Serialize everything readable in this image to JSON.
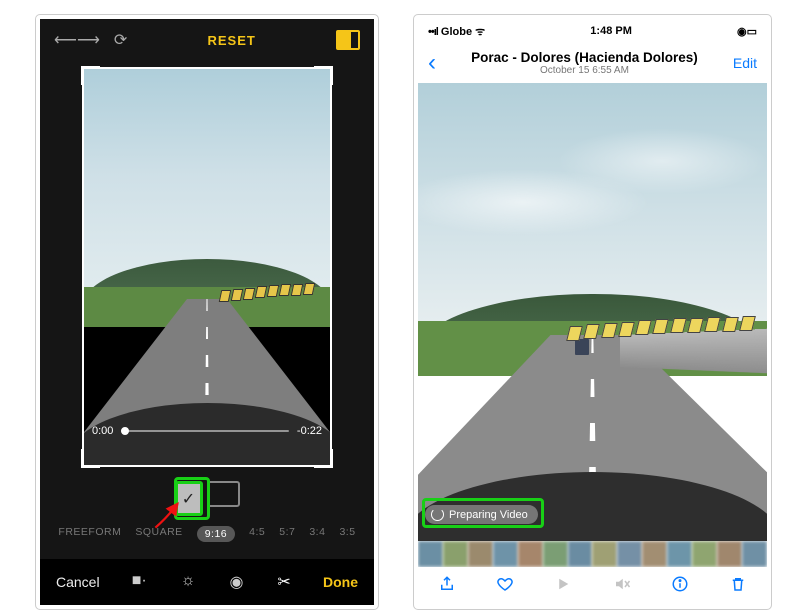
{
  "editor": {
    "reset_label": "RESET",
    "time_current": "0:00",
    "time_remaining": "-0:22",
    "orientation_check": "✓",
    "ratios": {
      "freeform": "FREEFORM",
      "square": "SQUARE",
      "r916": "9:16",
      "r45": "4:5",
      "r57": "5:7",
      "r34": "3:4",
      "r35": "3:5"
    },
    "cancel_label": "Cancel",
    "done_label": "Done"
  },
  "viewer": {
    "status": {
      "carrier": "Globe",
      "time": "1:48 PM"
    },
    "title": "Porac - Dolores (Hacienda Dolores)",
    "subtitle": "October 15  6:55 AM",
    "edit_label": "Edit",
    "preparing_label": "Preparing Video"
  }
}
